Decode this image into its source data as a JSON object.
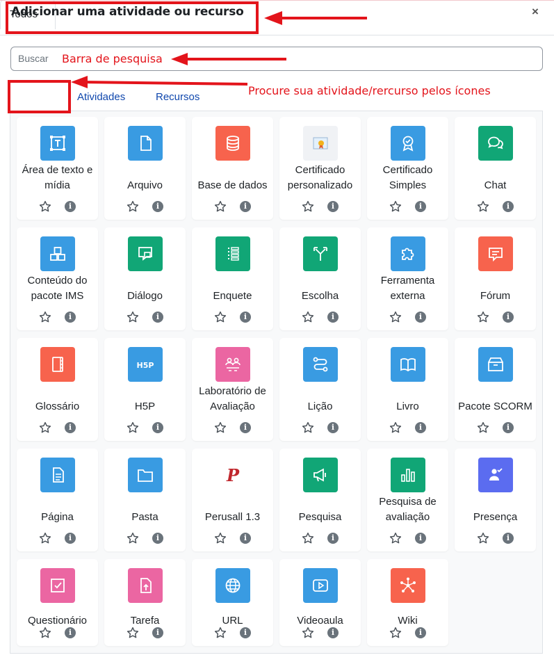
{
  "modal": {
    "title": "Adicionar uma atividade ou recurso",
    "close_glyph": "×"
  },
  "search": {
    "placeholder": "Buscar"
  },
  "annotations": {
    "search": "Barra de pesquisa",
    "tabs": "Procure sua atividade/rercurso pelos ícones"
  },
  "tabs": [
    {
      "label": "Todos",
      "active": true
    },
    {
      "label": "Atividades",
      "active": false
    },
    {
      "label": "Recursos",
      "active": false
    }
  ],
  "info_glyph": "i",
  "items": [
    {
      "label": "Área de texto e mídia",
      "icon": "text-media-icon",
      "color": "#399be2"
    },
    {
      "label": "Arquivo",
      "icon": "file-icon",
      "color": "#399be2"
    },
    {
      "label": "Base de dados",
      "icon": "database-icon",
      "color": "#f7634d"
    },
    {
      "label": "Certificado personalizado",
      "icon": "certificate-image-icon",
      "color": "#f0f2f5"
    },
    {
      "label": "Certificado Simples",
      "icon": "award-icon",
      "color": "#399be2"
    },
    {
      "label": "Chat",
      "icon": "chat-icon",
      "color": "#11a676"
    },
    {
      "label": "Conteúdo do pacote IMS",
      "icon": "ims-package-icon",
      "color": "#399be2"
    },
    {
      "label": "Diálogo",
      "icon": "dialogue-icon",
      "color": "#11a676"
    },
    {
      "label": "Enquete",
      "icon": "feedback-list-icon",
      "color": "#11a676"
    },
    {
      "label": "Escolha",
      "icon": "choice-icon",
      "color": "#11a676"
    },
    {
      "label": "Ferramenta externa",
      "icon": "puzzle-icon",
      "color": "#399be2"
    },
    {
      "label": "Fórum",
      "icon": "forum-icon",
      "color": "#f7634d"
    },
    {
      "label": "Glossário",
      "icon": "glossary-icon",
      "color": "#f7634d"
    },
    {
      "label": "H5P",
      "icon": "h5p-icon",
      "color": "#399be2"
    },
    {
      "label": "Laboratório de Avaliação",
      "icon": "workshop-icon",
      "color": "#eb66a2"
    },
    {
      "label": "Lição",
      "icon": "lesson-icon",
      "color": "#399be2"
    },
    {
      "label": "Livro",
      "icon": "book-icon",
      "color": "#399be2"
    },
    {
      "label": "Pacote SCORM",
      "icon": "scorm-box-icon",
      "color": "#399be2"
    },
    {
      "label": "Página",
      "icon": "page-icon",
      "color": "#399be2"
    },
    {
      "label": "Pasta",
      "icon": "folder-icon",
      "color": "#399be2"
    },
    {
      "label": "Perusall 1.3",
      "icon": "perusall-icon",
      "color": "#ffffff"
    },
    {
      "label": "Pesquisa",
      "icon": "megaphone-icon",
      "color": "#11a676"
    },
    {
      "label": "Pesquisa de avaliação",
      "icon": "bar-chart-icon",
      "color": "#11a676"
    },
    {
      "label": "Presença",
      "icon": "attendance-icon",
      "color": "#5b6cf0"
    },
    {
      "label": "Questionário",
      "icon": "quiz-icon",
      "color": "#eb66a2"
    },
    {
      "label": "Tarefa",
      "icon": "assignment-icon",
      "color": "#eb66a2"
    },
    {
      "label": "URL",
      "icon": "globe-icon",
      "color": "#399be2"
    },
    {
      "label": "Videoaula",
      "icon": "video-icon",
      "color": "#399be2"
    },
    {
      "label": "Wiki",
      "icon": "wiki-network-icon",
      "color": "#f7634d"
    }
  ],
  "colors": {
    "annotation": "#e3141b",
    "link": "#0f47ad"
  }
}
